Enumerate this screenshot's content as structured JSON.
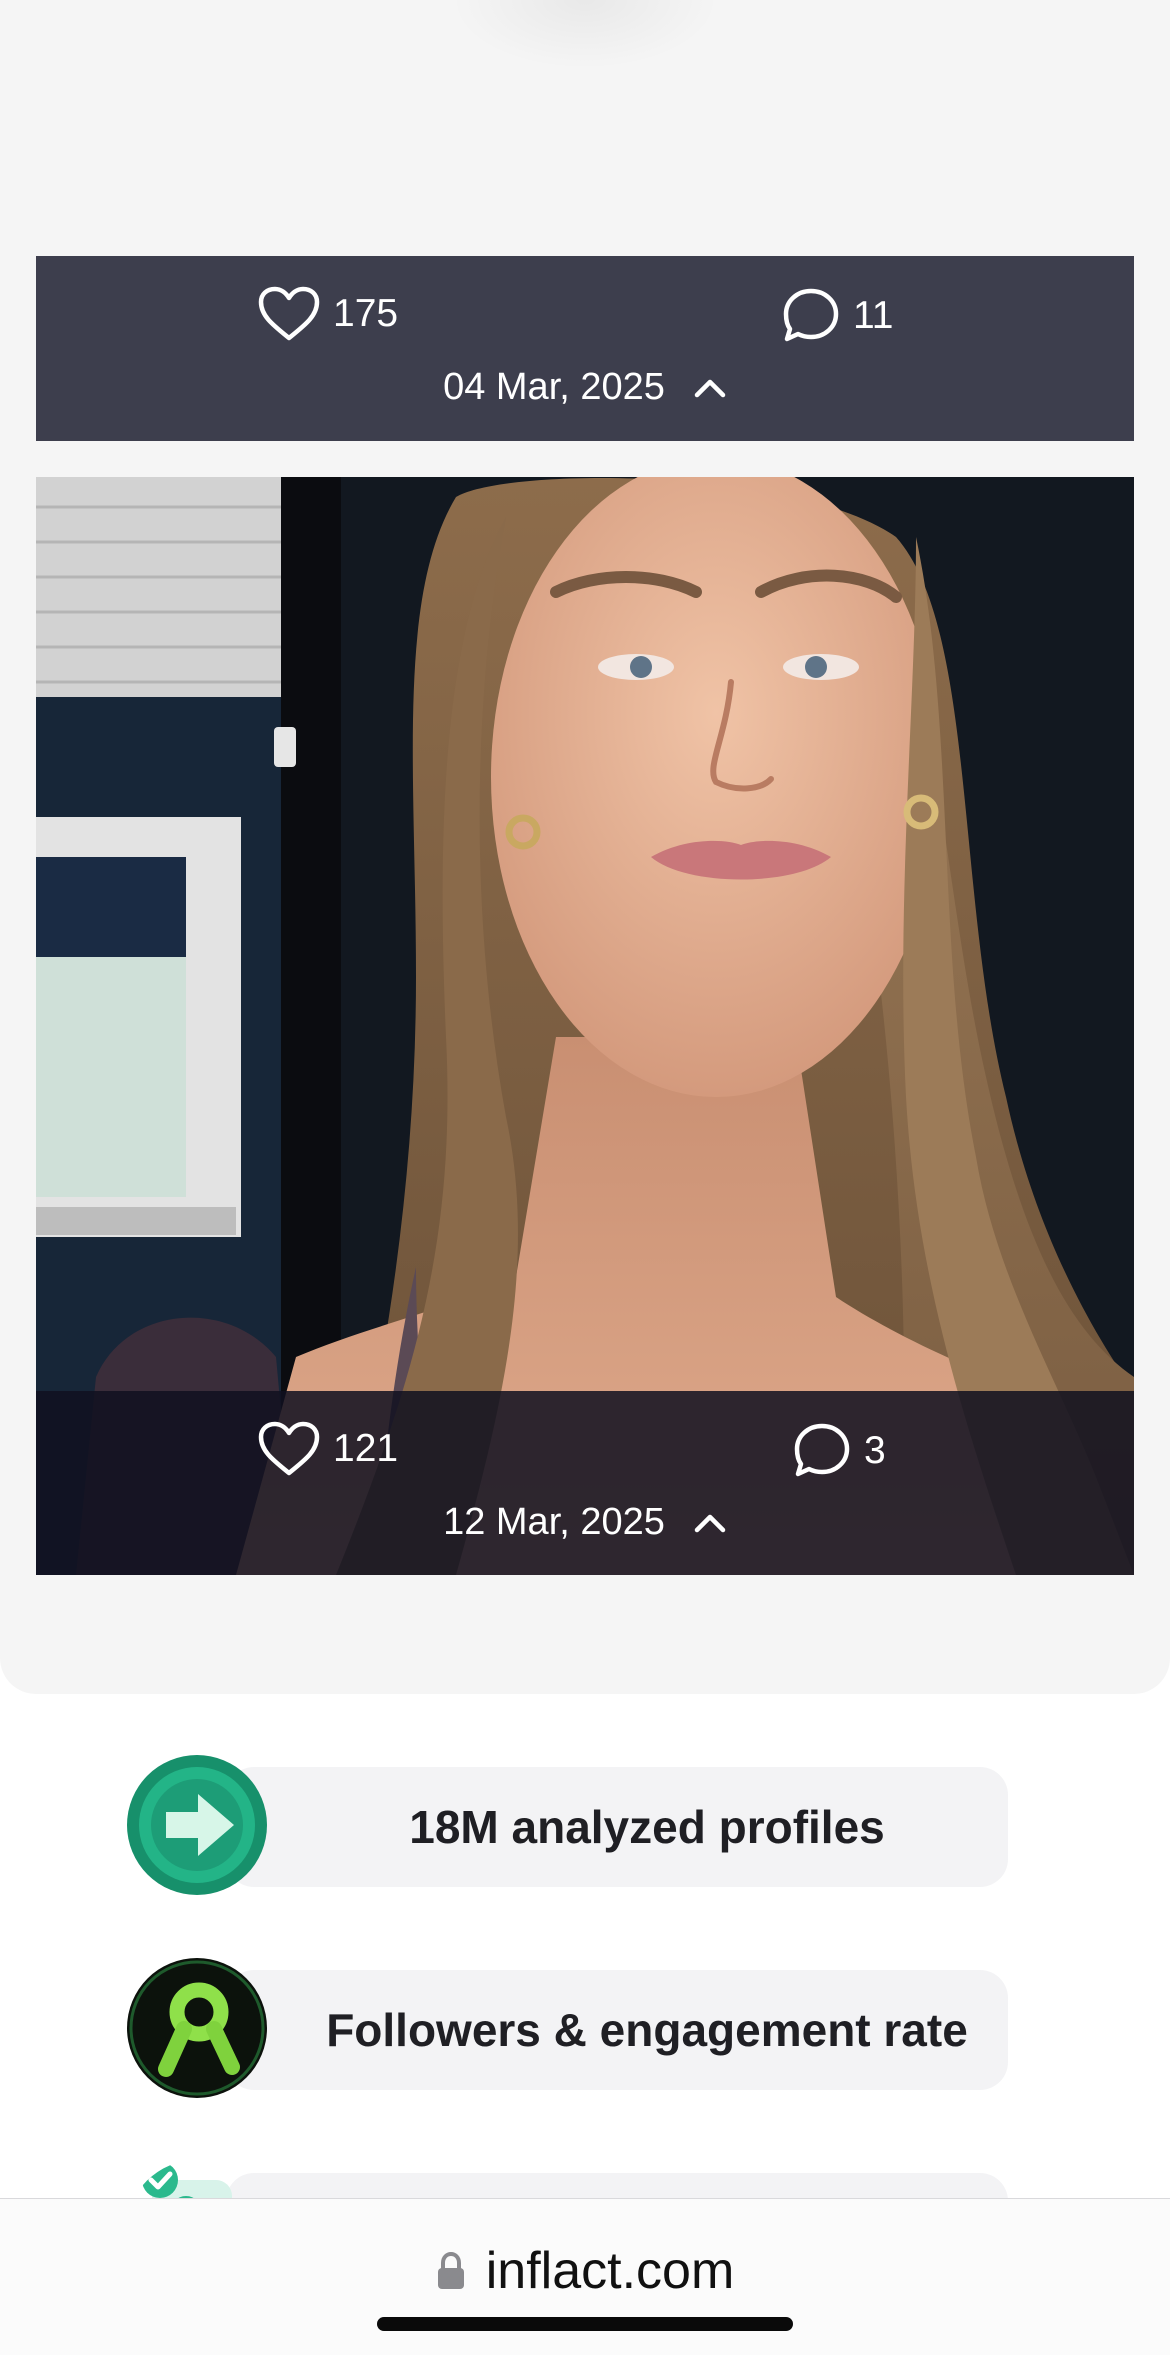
{
  "posts": [
    {
      "likes": "175",
      "comments": "11",
      "date": "04 Mar, 2025"
    },
    {
      "likes": "121",
      "comments": "3",
      "date": "12 Mar, 2025"
    }
  ],
  "features": [
    {
      "label": "18M analyzed profiles",
      "icon": "arrow-badge-icon"
    },
    {
      "label": "Followers & engagement rate",
      "icon": "green-figure-badge-icon"
    },
    {
      "label": "",
      "icon": "checkmark-badge-icon"
    }
  ],
  "browser": {
    "url": "inflact.com"
  },
  "colors": {
    "stats_bar": "#3d3e4d",
    "accent_green": "#1fae84",
    "lime": "#8fe04a"
  }
}
